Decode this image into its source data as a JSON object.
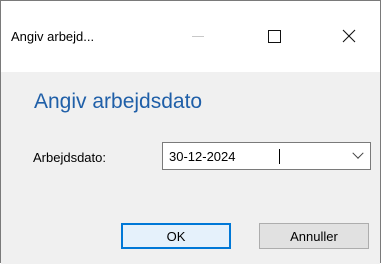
{
  "window": {
    "title": "Angiv arbejd...",
    "controls": {
      "minimize_icon": "minimize-icon",
      "maximize_icon": "maximize-icon",
      "close_icon": "close-icon",
      "close_glyph": "✕"
    }
  },
  "dialog": {
    "heading": "Angiv arbejdsdato",
    "field_label": "Arbejdsdato:",
    "date_value": "30-12-2024",
    "dropdown_icon": "chevron-down-icon"
  },
  "buttons": {
    "ok_label": "OK",
    "cancel_label": "Annuller"
  },
  "colors": {
    "heading": "#1f5fa8",
    "default_button_border": "#0078d7",
    "default_button_bg": "#e5f1fb",
    "button_bg": "#e1e1e1",
    "client_bg": "#f0f0f0"
  }
}
